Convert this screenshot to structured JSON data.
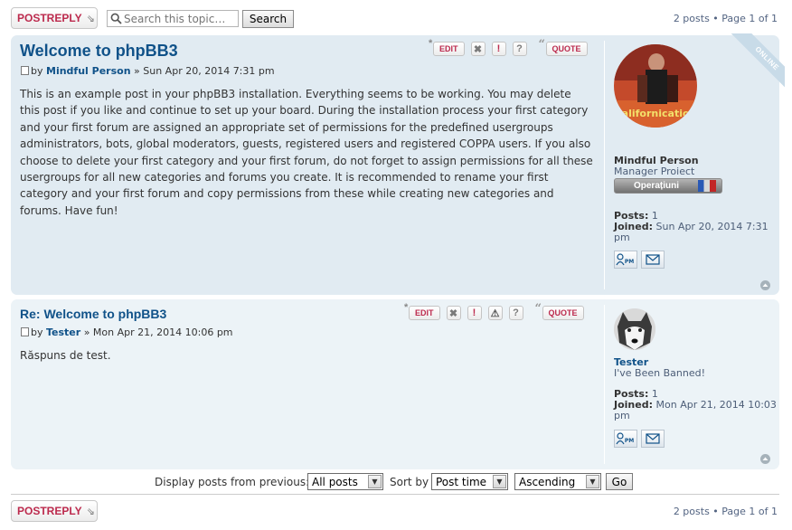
{
  "toolbar": {
    "postreply_label": "POSTREPLY",
    "search_placeholder": "Search this topic…",
    "search_button": "Search",
    "pagination": "2 posts • Page 1 of 1"
  },
  "posts": [
    {
      "title": "Welcome to phpBB3",
      "by": "by",
      "author": "Mindful Person",
      "datetime": "» Sun Apr 20, 2014 7:31 pm",
      "content": "This is an example post in your phpBB3 installation. Everything seems to be working. You may delete this post if you like and continue to set up your board. During the installation process your first category and your first forum are assigned an appropriate set of permissions for the predefined usergroups administrators, bots, global moderators, guests, registered users and registered COPPA users. If you also choose to delete your first category and your first forum, do not forget to assign permissions for all these usergroups for all new categories and forums you create. It is recommended to rename your first category and your first forum and copy permissions from these while creating new categories and forums. Have fun!",
      "edit_label": "EDIT",
      "quote_label": "QUOTE",
      "profile": {
        "online_badge": "ONLINE",
        "avatar_text": "Californication",
        "name": "Mindful Person",
        "rank": "Manager Proiect",
        "rank_badge": "Operațiuni",
        "posts_label": "Posts:",
        "posts_value": "1",
        "joined_label": "Joined:",
        "joined_value": "Sun Apr 20, 2014 7:31 pm"
      }
    },
    {
      "title": "Re: Welcome to phpBB3",
      "by": "by",
      "author": "Tester",
      "datetime": "» Mon Apr 21, 2014 10:06 pm",
      "content": "Răspuns de test.",
      "edit_label": "EDIT",
      "quote_label": "QUOTE",
      "profile": {
        "name": "Tester",
        "rank": "I've Been Banned!",
        "posts_label": "Posts:",
        "posts_value": "1",
        "joined_label": "Joined:",
        "joined_value": "Mon Apr 21, 2014 10:03 pm"
      }
    }
  ],
  "sortbar": {
    "display_label": "Display posts from previous:",
    "display_value": "All posts",
    "sort_label": "Sort by",
    "sort_value": "Post time",
    "order_value": "Ascending",
    "go_label": "Go"
  },
  "icons": {
    "pm": "PM",
    "email": "email-icon",
    "delete": "delete-icon",
    "report": "report-icon",
    "warn": "warn-icon",
    "info": "info-icon",
    "top": "top-icon"
  },
  "colors": {
    "link": "#105289",
    "button_text": "#bc2a4d",
    "post_bg_1": "#e1ebf2",
    "post_bg_2": "#ecf3f7"
  }
}
